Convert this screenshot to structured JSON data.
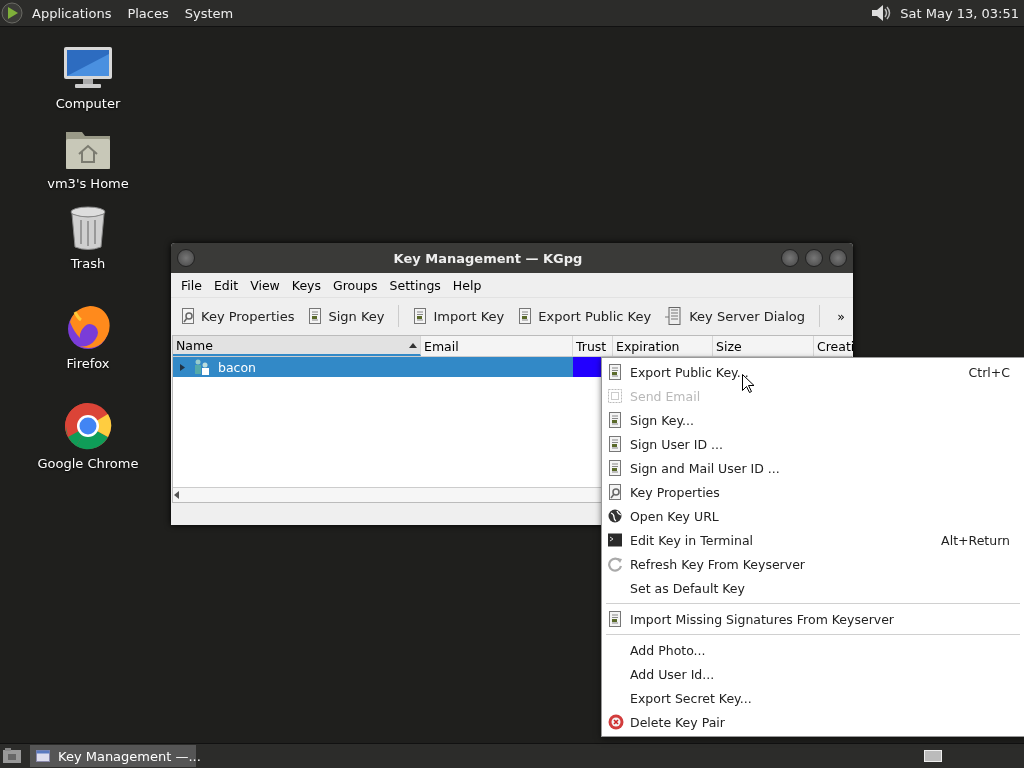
{
  "top_panel": {
    "menus": [
      "Applications",
      "Places",
      "System"
    ],
    "clock": "Sat May 13, 03:51"
  },
  "desktop_icons": [
    {
      "label": "Computer",
      "kind": "computer"
    },
    {
      "label": "vm3's Home",
      "kind": "home"
    },
    {
      "label": "Trash",
      "kind": "trash"
    },
    {
      "label": "Firefox",
      "kind": "fox"
    },
    {
      "label": "Google Chrome",
      "kind": "ring"
    }
  ],
  "window": {
    "title": "Key Management — KGpg",
    "menu_bar": [
      "File",
      "Edit",
      "View",
      "Keys",
      "Groups",
      "Settings",
      "Help"
    ],
    "toolbar": {
      "groups": [
        [
          {
            "label": "Key Properties",
            "kind": "magnifier"
          },
          {
            "label": "Sign Key",
            "kind": "document"
          }
        ],
        [
          {
            "label": "Import Key",
            "kind": "document"
          },
          {
            "label": "Export Public Key",
            "kind": "document"
          },
          {
            "label": "Key Server Dialog",
            "kind": "server"
          }
        ]
      ],
      "overflow": "»"
    },
    "table": {
      "columns": [
        {
          "label": "Name",
          "sorted": true
        },
        {
          "label": "Email",
          "sorted": false
        },
        {
          "label": "Trust",
          "sorted": false
        },
        {
          "label": "Expiration",
          "sorted": false
        },
        {
          "label": "Size",
          "sorted": false
        },
        {
          "label": "Creati",
          "sorted": false
        }
      ],
      "rows": [
        {
          "name": "bacon",
          "selected": true,
          "expanded": false,
          "color": "#2200ff"
        }
      ]
    }
  },
  "context_menu": {
    "sections": [
      [
        {
          "label": "Export Public Key...",
          "kind": "document",
          "disabled": false,
          "shortcut": "Ctrl+C"
        },
        {
          "label": "Send Email",
          "kind": "dashed",
          "disabled": true
        },
        {
          "label": "Sign Key...",
          "kind": "document",
          "disabled": false
        },
        {
          "label": "Sign User ID ...",
          "kind": "document",
          "disabled": false
        },
        {
          "label": "Sign and Mail User ID ...",
          "kind": "document",
          "disabled": false
        },
        {
          "label": "Key Properties",
          "kind": "magnifier",
          "disabled": false
        },
        {
          "label": "Open Key URL",
          "kind": "globe",
          "disabled": false
        },
        {
          "label": "Edit Key in Terminal",
          "kind": "terminal",
          "disabled": false,
          "shortcut": "Alt+Return"
        },
        {
          "label": "Refresh Key From Keyserver",
          "kind": "refresh",
          "disabled": false
        },
        {
          "label": "Set as Default Key",
          "kind": "plain",
          "disabled": false
        }
      ],
      [
        {
          "label": "Import Missing Signatures From Keyserver",
          "kind": "document",
          "disabled": false
        }
      ],
      [
        {
          "label": "Add Photo...",
          "kind": "plain",
          "disabled": false
        },
        {
          "label": "Add User Id...",
          "kind": "plain",
          "disabled": false
        },
        {
          "label": "Export Secret Key...",
          "kind": "plain",
          "disabled": false
        },
        {
          "label": "Delete Key Pair",
          "kind": "delete",
          "disabled": false
        }
      ]
    ]
  },
  "taskbar": {
    "tasks": [
      {
        "label": "Key Management —...",
        "selected": true
      }
    ]
  }
}
